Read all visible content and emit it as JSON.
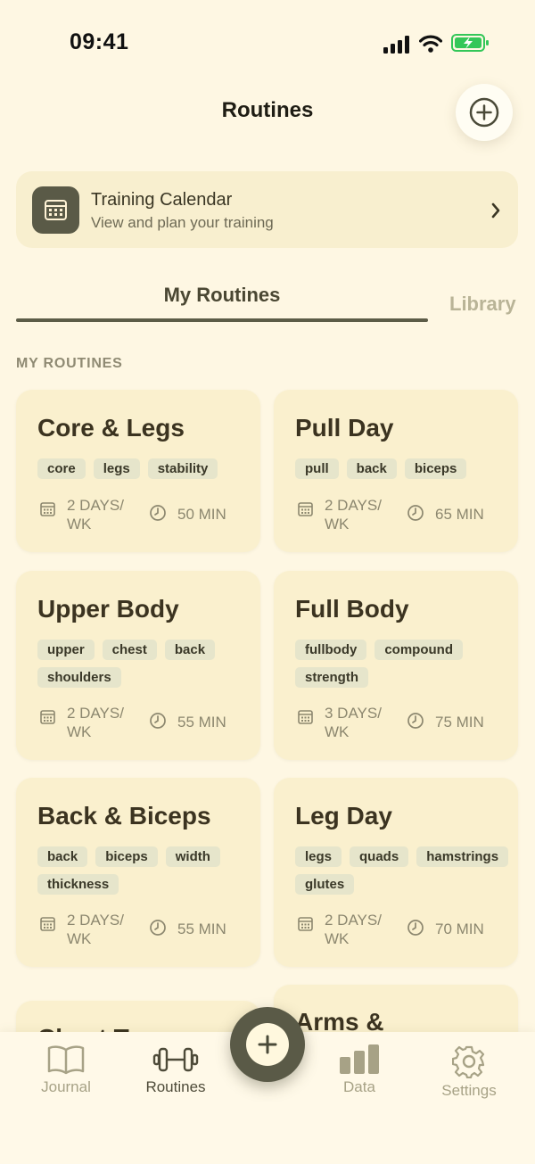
{
  "status": {
    "time": "09:41"
  },
  "header": {
    "title": "Routines"
  },
  "calendar": {
    "title": "Training Calendar",
    "subtitle": "View and plan your training"
  },
  "tabs": {
    "active": "My Routines",
    "inactive": "Library"
  },
  "section_label": "MY ROUTINES",
  "routines": [
    {
      "title": "Core & Legs",
      "tags": [
        "core",
        "legs",
        "stability"
      ],
      "days": "2 DAYS/\nWK",
      "duration": "50 MIN"
    },
    {
      "title": "Pull Day",
      "tags": [
        "pull",
        "back",
        "biceps"
      ],
      "days": "2 DAYS/\nWK",
      "duration": "65 MIN"
    },
    {
      "title": "Upper Body",
      "tags": [
        "upper",
        "chest",
        "back",
        "shoulders"
      ],
      "days": "2 DAYS/\nWK",
      "duration": "55 MIN"
    },
    {
      "title": "Full Body",
      "tags": [
        "fullbody",
        "compound",
        "strength"
      ],
      "days": "3 DAYS/\nWK",
      "duration": "75 MIN"
    },
    {
      "title": "Back & Biceps",
      "tags": [
        "back",
        "biceps",
        "width",
        "thickness"
      ],
      "days": "2 DAYS/\nWK",
      "duration": "55 MIN"
    },
    {
      "title": "Leg Day",
      "tags": [
        "legs",
        "quads",
        "hamstrings",
        "glutes"
      ],
      "days": "2 DAYS/\nWK",
      "duration": "70 MIN"
    }
  ],
  "partial_cards": [
    {
      "title": "Chest T"
    },
    {
      "title": "Arms &"
    }
  ],
  "tabbar": {
    "journal": "Journal",
    "routines": "Routines",
    "data": "Data",
    "settings": "Settings"
  },
  "colors": {
    "background": "#FEF7E3",
    "card": "#FAF0CE",
    "accent": "#5A5A47",
    "tag": "#E6E5CB",
    "battery": "#34C759"
  }
}
